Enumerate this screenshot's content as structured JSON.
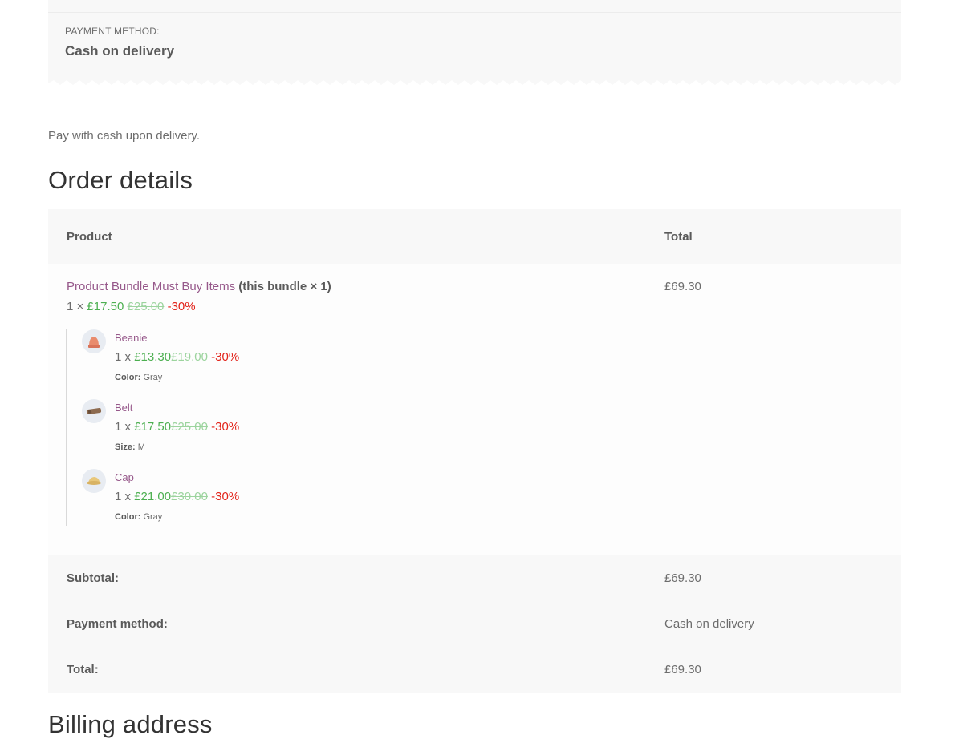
{
  "payment_box": {
    "label": "PAYMENT METHOD:",
    "value": "Cash on delivery"
  },
  "pay_note": "Pay with cash upon delivery.",
  "order_details": {
    "title": "Order details",
    "columns": {
      "product": "Product",
      "total": "Total"
    },
    "bundle": {
      "name": "Product Bundle Must Buy Items",
      "suffix": "(this bundle × 1)",
      "qty_prefix": "1 ×",
      "price": "£17.50",
      "old_price": "£25.00",
      "discount": "-30%",
      "total": "£69.30"
    },
    "items": [
      {
        "name": "Beanie",
        "qty_prefix": "1 x",
        "price": "£13.30",
        "old_price": "£19.00",
        "discount": "-30%",
        "meta_label": "Color:",
        "meta_value": "Gray",
        "icon": "beanie-icon"
      },
      {
        "name": "Belt",
        "qty_prefix": "1 x",
        "price": "£17.50",
        "old_price": "£25.00",
        "discount": "-30%",
        "meta_label": "Size:",
        "meta_value": "M",
        "icon": "belt-icon"
      },
      {
        "name": "Cap",
        "qty_prefix": "1 x",
        "price": "£21.00",
        "old_price": "£30.00",
        "discount": "-30%",
        "meta_label": "Color:",
        "meta_value": "Gray",
        "icon": "cap-icon"
      }
    ],
    "footer": [
      {
        "label": "Subtotal:",
        "value": "£69.30"
      },
      {
        "label": "Payment method:",
        "value": "Cash on delivery"
      },
      {
        "label": "Total:",
        "value": "£69.30"
      }
    ]
  },
  "billing": {
    "title": "Billing address"
  },
  "colors": {
    "link": "#96588a",
    "sale_price": "#4caf50",
    "discount": "#e2231a"
  }
}
